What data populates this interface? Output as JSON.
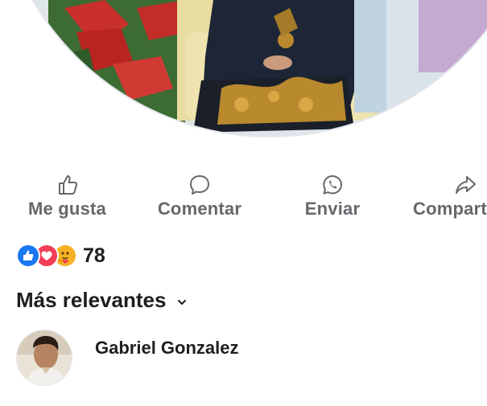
{
  "post": {
    "actions": [
      {
        "label": "Me gusta",
        "icon": "thumbs-up-icon"
      },
      {
        "label": "Comentar",
        "icon": "comment-bubble-icon"
      },
      {
        "label": "Enviar",
        "icon": "whatsapp-icon"
      },
      {
        "label": "Compartir",
        "icon": "share-arrow-icon"
      }
    ],
    "reactions": {
      "icons": [
        "like-reaction-icon",
        "love-reaction-icon",
        "care-reaction-icon"
      ],
      "count": "78"
    }
  },
  "comments": {
    "sort_label": "Más relevantes",
    "items": [
      {
        "author": "Gabriel Gonzalez",
        "avatar": "avatar"
      }
    ]
  },
  "colors": {
    "action_text": "#65676b",
    "like_blue": "#1877f2",
    "love_red": "#f33e58",
    "care_yellow": "#f7b125"
  }
}
